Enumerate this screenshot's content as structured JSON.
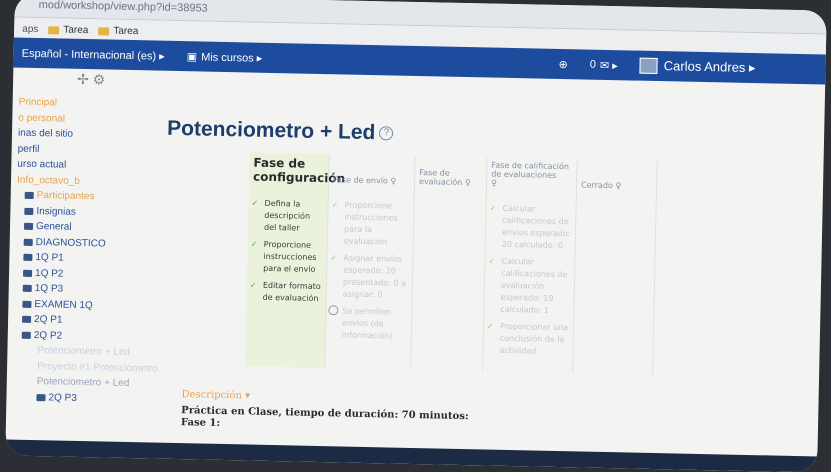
{
  "browser": {
    "url": "mod/workshop/view.php?id=38953",
    "bookmarks": [
      "Tarea",
      "Tarea"
    ]
  },
  "navbar": {
    "language": "Español - Internacional (es) ▸",
    "my_courses": "Mis cursos ▸",
    "messages_count": "0",
    "user_name": "Carlos Andres ▸"
  },
  "sidebar": {
    "items": [
      {
        "label": "Principal",
        "style": "orange"
      },
      {
        "label": "o personal",
        "style": "orange"
      },
      {
        "label": "inas del sitio",
        "style": "normal"
      },
      {
        "label": "perfil",
        "style": "normal"
      },
      {
        "label": "urso actual",
        "style": "normal"
      },
      {
        "label": "Info_octavo_b",
        "style": "orange"
      },
      {
        "label": "Participantes",
        "style": "orange",
        "icon": true
      },
      {
        "label": "Insignias",
        "style": "normal",
        "icon": true
      },
      {
        "label": "General",
        "style": "normal",
        "icon": true
      },
      {
        "label": "DIAGNOSTICO",
        "style": "normal",
        "icon": true
      },
      {
        "label": "1Q P1",
        "style": "normal",
        "icon": true
      },
      {
        "label": "1Q P2",
        "style": "normal",
        "icon": true
      },
      {
        "label": "1Q P3",
        "style": "normal",
        "icon": true
      },
      {
        "label": "EXAMEN 1Q",
        "style": "normal",
        "icon": true
      },
      {
        "label": "2Q P1",
        "style": "normal",
        "icon": true
      },
      {
        "label": "2Q P2",
        "style": "normal",
        "icon": true
      },
      {
        "label": "Potenciometro + Led",
        "style": "faded"
      },
      {
        "label": "Proyecto #1 Potenciómetro",
        "style": "faded"
      },
      {
        "label": "Potenciometro + Led",
        "style": "dim"
      },
      {
        "label": "2Q P3",
        "style": "normal",
        "icon": true
      }
    ]
  },
  "page": {
    "title": "Potenciometro + Led",
    "description_heading": "Descripción ▾",
    "description_line1": "Práctica en Clase, tiempo de duración: 70 minutos:",
    "description_line2": "Fase 1:"
  },
  "phases": [
    {
      "title_lines": [
        "Fase de",
        "configuración"
      ],
      "active": true,
      "width": 80,
      "tasks": [
        {
          "text": "Defina la descripción del taller",
          "kind": "check"
        },
        {
          "text": "Proporcione instrucciones para el envío",
          "kind": "check"
        },
        {
          "text": "Editar formato de evaluación",
          "kind": "check"
        }
      ]
    },
    {
      "title_lines": [
        "",
        "",
        "Fase de envío ♀"
      ],
      "active": false,
      "width": 86,
      "tasks": [
        {
          "text": "Proporcione instrucciones para la evaluación",
          "kind": "check"
        },
        {
          "text": "Asignar envíos esperado: 20 presentado: 0 a asignar: 0",
          "kind": "check"
        },
        {
          "text": "Se permiten envíos (de información)",
          "kind": "info"
        }
      ]
    },
    {
      "title_lines": [
        "",
        "Fase de",
        "evaluación ♀"
      ],
      "active": false,
      "width": 72,
      "tasks": []
    },
    {
      "title_lines": [
        "Fase de calificación",
        "de evaluaciones",
        "♀"
      ],
      "active": false,
      "width": 90,
      "tasks": [
        {
          "text": "Calcular calificaciones de envíos esperado: 20 calculado: 0",
          "kind": "check"
        },
        {
          "text": "Calcular calificaciones de evaluación esperado: 19 calculado: 1",
          "kind": "check"
        },
        {
          "text": "Proporcionar una conclusión de la actividad",
          "kind": "check"
        }
      ]
    },
    {
      "title_lines": [
        "",
        "",
        "Cerrado ♀"
      ],
      "active": false,
      "width": 80,
      "tasks": []
    }
  ]
}
